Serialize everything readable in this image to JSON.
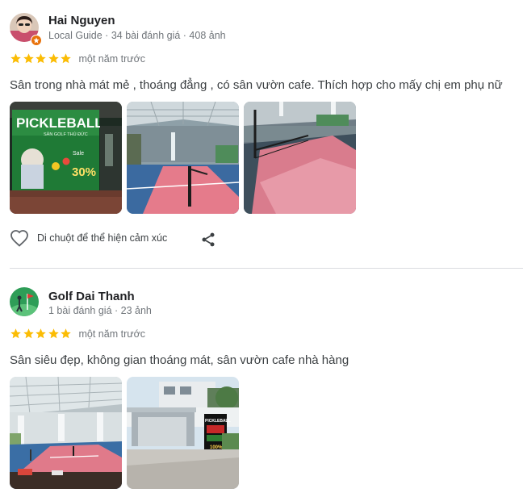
{
  "colors": {
    "star": "#fbbc04",
    "divider": "#dadce0",
    "meta": "#70757a"
  },
  "reviews": [
    {
      "author": "Hai Nguyen",
      "meta": "Local Guide · 34 bài đánh giá · 408 ảnh",
      "rating": 5,
      "date": "một năm trước",
      "text": "Sân trong nhà mát mẻ , thoáng đẳng , có sân vườn cafe. Thích hợp cho mấy chị em phụ nữ",
      "photo_count": 3,
      "reaction_prompt": "Di chuột để thể hiện cảm xúc",
      "photo1": {
        "banner_title": "PICKLEBALL",
        "banner_sub": "SÂN GOLF THỦ ĐỨC",
        "sale_label": "Sale",
        "sale_value": "30%"
      }
    },
    {
      "author": "Golf Dai Thanh",
      "meta": "1 bài đánh giá · 23 ảnh",
      "rating": 5,
      "date": "một năm trước",
      "text": "Sân siêu đẹp, không gian thoáng mát, sân vườn cafe nhà hàng",
      "photo_count": 2,
      "photo2": {
        "sign_title": "PICKLEBALL",
        "sign_sub": "100%"
      }
    }
  ]
}
